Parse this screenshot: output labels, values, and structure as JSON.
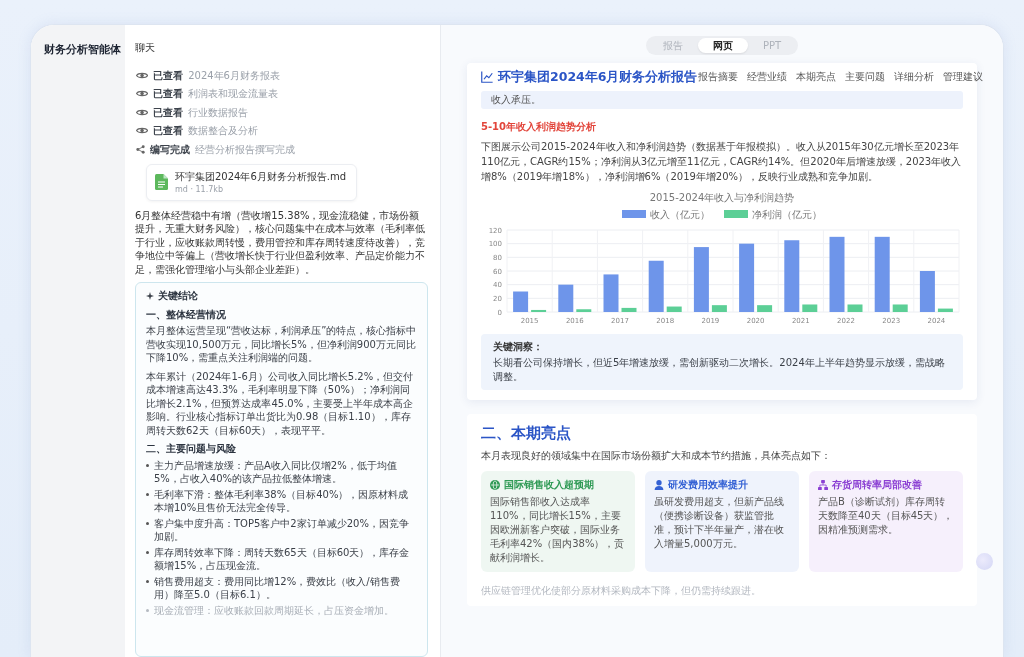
{
  "app": {
    "title": "财务分析智能体"
  },
  "chat": {
    "header": "聊天",
    "steps": [
      {
        "kind": "viewed",
        "status": "已查看",
        "text": "2024年6月财务报表"
      },
      {
        "kind": "viewed",
        "status": "已查看",
        "text": "利润表和现金流量表"
      },
      {
        "kind": "viewed",
        "status": "已查看",
        "text": "行业数据报告"
      },
      {
        "kind": "viewed",
        "status": "已查看",
        "text": "数据整合及分析"
      },
      {
        "kind": "written",
        "status": "编写完成",
        "text": "经营分析报告撰写完成"
      }
    ],
    "file": {
      "name": "环宇集团2024年6月财务分析报告.md",
      "meta": "md · 11.7kb"
    },
    "summary": "6月整体经营稳中有增（营收增15.38%，现金流稳健，市场份额提升，无重大财务风险），核心问题集中在成本与效率（毛利率低于行业，应收账款周转慢，费用管控和库存周转速度待改善），竞争地位中等偏上（营收增长快于行业但盈利效率、产品定价能力不足，需强化管理缩小与头部企业差距）。",
    "conclusions": {
      "title": "关键结论",
      "sections": [
        {
          "heading": "一、整体经营情况",
          "paragraphs": [
            "本月整体运营呈现“营收达标，利润承压”的特点，核心指标中营收实现10,500万元，同比增长5%，但净利润900万元同比下降10%，需重点关注利润端的问题。",
            "本年累计（2024年1-6月）公司收入同比增长5.2%，但交付成本增速高达43.3%，毛利率明显下降（50%）；净利润同比增长2.1%，但预算达成率45.0%，主要受上半年成本高企影响。行业核心指标订单出货比为0.98（目标1.10），库存周转天数62天（目标60天），表现平平。"
          ]
        },
        {
          "heading": "二、主要问题与风险",
          "bullets": [
            "主力产品增速放缓：产品A收入同比仅增2%，低于均值5%，占收入40%的该产品拉低整体增速。",
            "毛利率下滑：整体毛利率38%（目标40%），因原材料成本增10%且售价无法完全传导。",
            "客户集中度升高：TOP5客户中2家订单减少20%，因竞争加剧。",
            "库存周转效率下降：周转天数65天（目标60天），库存金额增15%，占压现金流。",
            "销售费用超支：费用同比增12%，费效比（收入/销售费用）降至5.0（目标6.1）。",
            "现金流管理：应收账款回款周期延长，占压资金增加。"
          ]
        }
      ]
    }
  },
  "report": {
    "view_tabs": [
      {
        "label": "报告",
        "selected": false
      },
      {
        "label": "网页",
        "selected": true
      },
      {
        "label": "PPT",
        "selected": false
      }
    ],
    "title": "环宇集团2024年6月财务分析报告",
    "nav": [
      "报告摘要",
      "经营业绩",
      "本期亮点",
      "主要问题",
      "详细分析",
      "管理建议"
    ],
    "note": "收入承压。",
    "trend": {
      "heading": "5-10年收入利润趋势分析",
      "text": "下图展示公司2015-2024年收入和净利润趋势（数据基于年报模拟）。收入从2015年30亿元增长至2023年110亿元，CAGR约15%；净利润从3亿元增至11亿元，CAGR约14%。但2020年后增速放缓，2023年收入增8%（2019年增18%），净利润增6%（2019年增20%），反映行业成熟和竞争加剧。",
      "chart_data": {
        "type": "bar",
        "title": "2015-2024年收入与净利润趋势",
        "categories": [
          "2015",
          "2016",
          "2017",
          "2018",
          "2019",
          "2020",
          "2021",
          "2022",
          "2023",
          "2024"
        ],
        "series": [
          {
            "name": "收入（亿元）",
            "color": "#6e95ea",
            "values": [
              30,
              40,
              55,
              75,
              95,
              100,
              105,
              110,
              110,
              60
            ]
          },
          {
            "name": "净利润（亿元）",
            "color": "#5ccf96",
            "values": [
              3,
              4,
              6,
              8,
              10,
              10,
              11,
              11,
              11,
              5
            ]
          }
        ],
        "ylim": [
          0,
          120
        ],
        "yticks": [
          0,
          20,
          40,
          60,
          80,
          100,
          120
        ],
        "grid": true,
        "legend": true
      },
      "insight": {
        "label": "关键洞察：",
        "text": "长期看公司保持增长，但近5年增速放缓，需创新驱动二次增长。2024年上半年趋势显示放缓，需战略调整。"
      }
    },
    "highlights": {
      "heading": "二、本期亮点",
      "intro": "本月表现良好的领域集中在国际市场份额扩大和成本节约措施，具体亮点如下：",
      "cards": [
        {
          "kind": "globe",
          "color": "#2f9a55",
          "title": "国际销售收入超预期",
          "text": "国际销售部收入达成率110%，同比增长15%，主要因欧洲新客户突破，国际业务毛利率42%（国内38%），贡献利润增长。"
        },
        {
          "kind": "user",
          "color": "#3461d4",
          "title": "研发费用效率提升",
          "text": "虽研发费用超支，但新产品线（便携诊断设备）获监管批准，预计下半年量产，潜在收入增量5,000万元。"
        },
        {
          "kind": "hierarchy",
          "color": "#8b3fd3",
          "title": "存货周转率局部改善",
          "text": "产品B（诊断试剂）库存周转天数降至40天（目标45天），因精准预测需求。"
        }
      ],
      "footnote": "供应链管理优化使部分原材料采购成本下降，但仍需持续跟进。"
    }
  }
}
